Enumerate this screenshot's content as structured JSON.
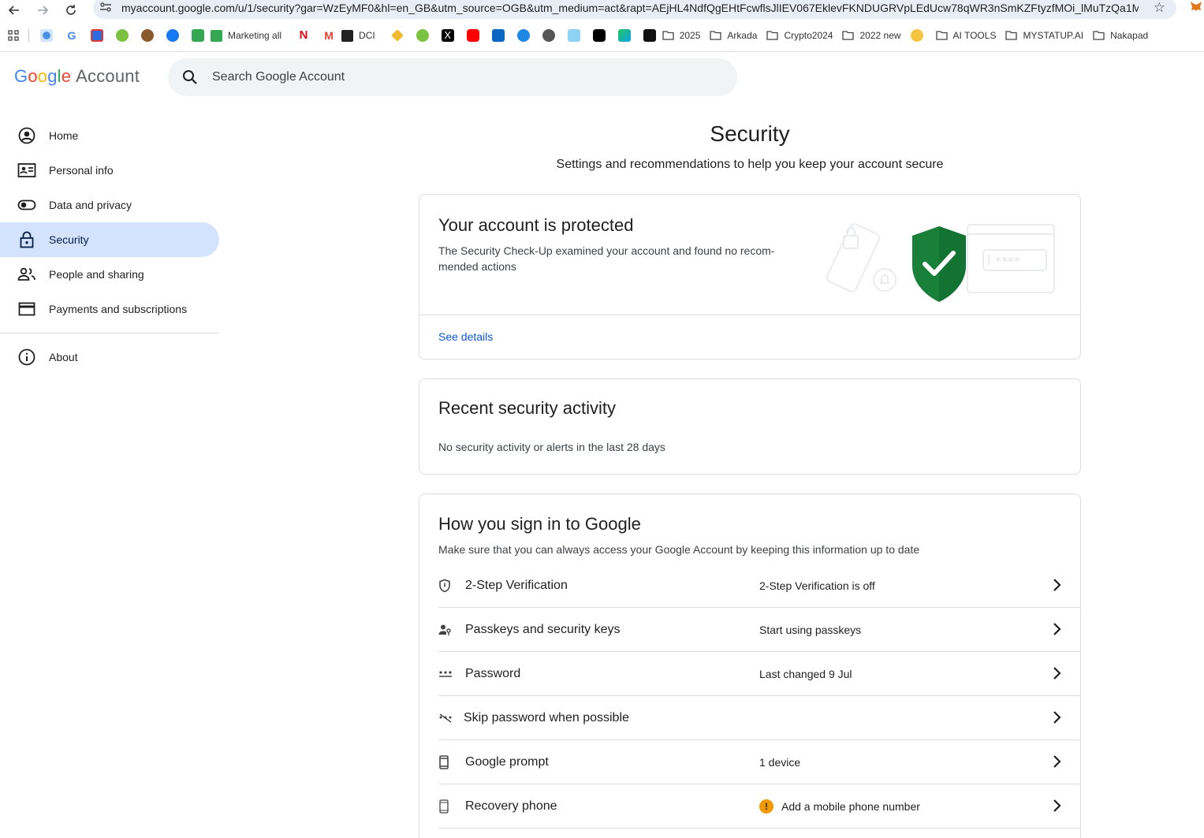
{
  "browser": {
    "url": "myaccount.google.com/u/1/security?gar=WzEyMF0&hl=en_GB&utm_source=OGB&utm_medium=act&rapt=AEjHL4NdfQgEHtFcwflsJlIEV067EklevFKNDUGRVpLEdUcw78qWR3nSmKZFtyzfMOi_lMuTzQa1MNZ...",
    "bookmarks": {
      "marketing": "Marketing all",
      "dci": "DCI",
      "folders": [
        "2025",
        "Arkada",
        "Crypto2024",
        "2022 new",
        "AI TOOLS",
        "MYSTATUP.AI",
        "Nakapad"
      ]
    }
  },
  "header": {
    "logo_google": "Google",
    "logo_account": "Account",
    "search_placeholder": "Search Google Account"
  },
  "sidebar": {
    "items": [
      {
        "label": "Home",
        "icon": "account-circle-icon"
      },
      {
        "label": "Personal info",
        "icon": "id-card-icon"
      },
      {
        "label": "Data and privacy",
        "icon": "toggle-icon"
      },
      {
        "label": "Security",
        "icon": "lock-icon",
        "active": true
      },
      {
        "label": "People and sharing",
        "icon": "people-icon"
      },
      {
        "label": "Payments and subscriptions",
        "icon": "credit-card-icon"
      }
    ],
    "about": "About"
  },
  "main": {
    "title": "Security",
    "subtitle": "Settings and recommendations to help you keep your account secure",
    "protected_card": {
      "title": "Your account is protected",
      "description": "The Security Check-Up examined your account and found no recom­mended actions",
      "link": "See details"
    },
    "activity_card": {
      "title": "Recent security activity",
      "description": "No security activity or alerts in the last 28 days"
    },
    "signin_card": {
      "title": "How you sign in to Google",
      "description": "Make sure that you can always access your Google Account by keeping this information up to date",
      "rows": [
        {
          "label": "2-Step Verification",
          "value": "2-Step Verification is off"
        },
        {
          "label": "Passkeys and security keys",
          "value": "Start using passkeys"
        },
        {
          "label": "Password",
          "value": "Last changed 9 Jul"
        },
        {
          "label": "Skip password when possible",
          "value": ""
        },
        {
          "label": "Google prompt",
          "value": "1 device"
        },
        {
          "label": "Recovery phone",
          "value": "Add a mobile phone number",
          "warning": "!"
        }
      ]
    }
  },
  "colors": {
    "accent": "#0b57d0",
    "active_nav": "#d3e3fd",
    "shield": "#188038",
    "warning": "#f29900"
  }
}
